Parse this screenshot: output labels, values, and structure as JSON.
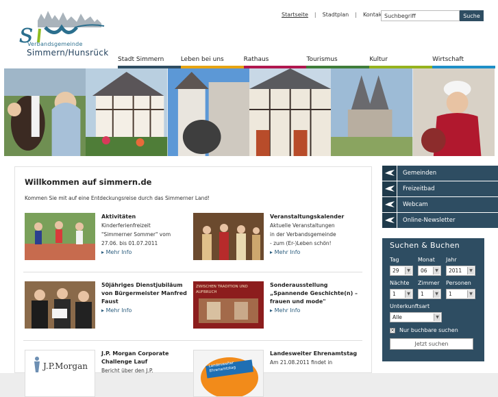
{
  "logo": {
    "sub": "Verbandsgemeinde",
    "main": "Simmern/Hunsrück"
  },
  "topnav": {
    "home": "Startseite",
    "map": "Stadtplan",
    "contact": "Kontakt",
    "sep": "|"
  },
  "search": {
    "placeholder": "Suchbegriff",
    "button": "Suche"
  },
  "mainnav": [
    {
      "label": "Stadt Simmern",
      "color": "#2e4d62"
    },
    {
      "label": "Leben bei uns",
      "color": "#e6a413"
    },
    {
      "label": "Rathaus",
      "color": "#b0174f"
    },
    {
      "label": "Tourismus",
      "color": "#3f7d3a"
    },
    {
      "label": "Kultur",
      "color": "#95b21d"
    },
    {
      "label": "Wirtschaft",
      "color": "#1e8fc7"
    }
  ],
  "welcome": {
    "title": "Willkommen auf simmern.de",
    "intro": "Kommen Sie mit auf eine Entdeckungsreise durch das Simmerner Land!"
  },
  "news": [
    {
      "title": "Aktivitäten",
      "lines": [
        "Kinderferienfreizeit",
        "\"Simmerner Sommer\" vom",
        "27.06. bis 01.07.2011"
      ],
      "more": "Mehr Info"
    },
    {
      "title": "Veranstaltungskalender",
      "lines": [
        "Aktuelle Veranstaltungen",
        "in der Verbandsgemeinde",
        "- zum (Er-)Leben schön!"
      ],
      "more": "Mehr Info"
    },
    {
      "title": "50jähriges Dienstjubiläum von Bürgermeister Manfred Faust",
      "lines": [],
      "more": "Mehr Info"
    },
    {
      "title": "Sonderausstellung „Spannende Geschichte(n) – frauen und mode\"",
      "lines": [],
      "more": "Mehr Info"
    },
    {
      "title": "J.P. Morgan Corporate Challenge Lauf",
      "lines": [
        "Bericht über den J.P."
      ],
      "more": ""
    },
    {
      "title": "Landesweiter Ehrenamtstag",
      "lines": [
        "Am 21.08.2011 findet in"
      ],
      "more": ""
    }
  ],
  "thumb_text": {
    "tradition": "ZWISCHEN TRADITION UND AUFBRUCH",
    "jpmorgan": "J.P.Morgan",
    "ehrenamt": "Landesweiter Ehrenamtstag"
  },
  "sidenav": [
    "Gemeinden",
    "Freizeitbad",
    "Webcam",
    "Online-Newsletter"
  ],
  "booking": {
    "title": "Suchen & Buchen",
    "tag_label": "Tag",
    "tag": "29",
    "monat_label": "Monat",
    "monat": "06",
    "jahr_label": "Jahr",
    "jahr": "2011",
    "naechte_label": "Nächte",
    "naechte": "1",
    "zimmer_label": "Zimmer",
    "zimmer": "1",
    "personen_label": "Personen",
    "personen": "1",
    "art_label": "Unterkunftsart",
    "art": "Alle",
    "only_bookable": "Nur buchbare suchen",
    "button": "Jetzt suchen"
  }
}
